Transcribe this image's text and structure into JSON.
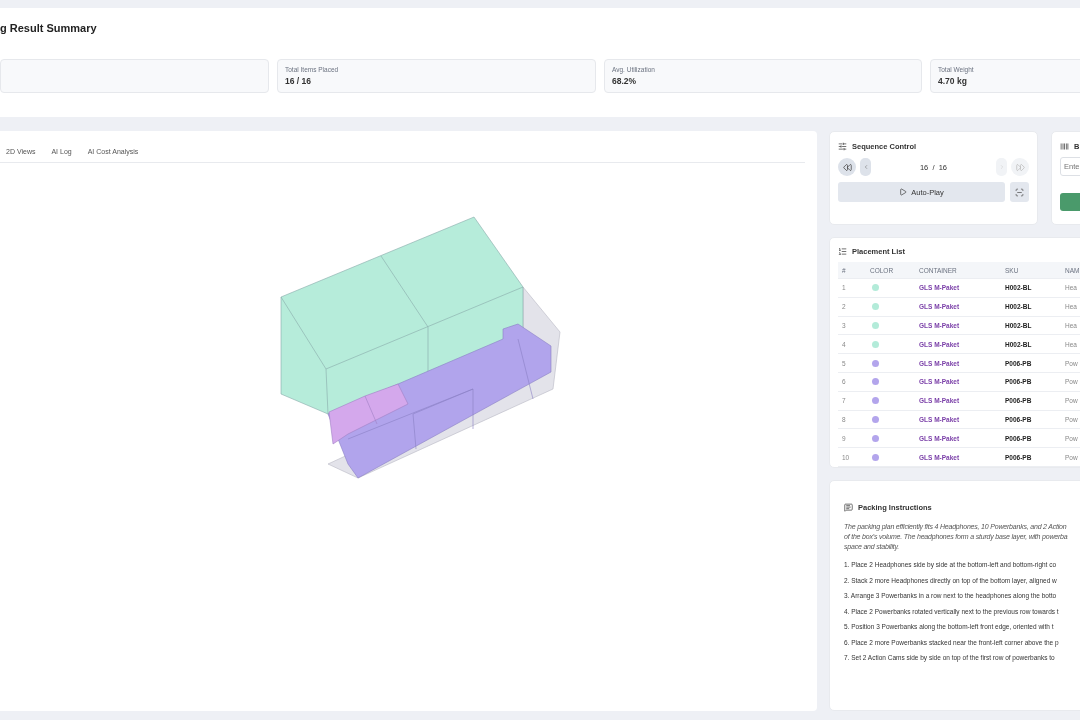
{
  "summary": {
    "title": "g Result Summary",
    "stats": [
      {
        "label": "Total Items Placed",
        "value": "16 / 16"
      },
      {
        "label": "Avg. Utilization",
        "value": "68.2%"
      },
      {
        "label": "Total Weight",
        "value": "4.70 kg"
      }
    ]
  },
  "tabs": [
    {
      "label": "2D Views",
      "selected": false
    },
    {
      "label": "AI Log",
      "selected": false
    },
    {
      "label": "AI Cost Analysis",
      "selected": false
    }
  ],
  "sequence": {
    "title": "Sequence Control",
    "counter": "16  /  16",
    "controls": [
      {
        "kind": "first",
        "disabled": false
      },
      {
        "kind": "prev",
        "disabled": false
      },
      {
        "kind": "next",
        "disabled": true
      },
      {
        "kind": "last",
        "disabled": true
      }
    ],
    "autoplay": "Auto-Play"
  },
  "barcode": {
    "title": "B",
    "placeholder": "Ente"
  },
  "placement": {
    "title": "Placement List",
    "columns": [
      "#",
      "COLOR",
      "CONTAINER",
      "SKU",
      "NAM"
    ],
    "rows": [
      {
        "index": "1",
        "color": "#b3ebd9",
        "container": "GLS M-Paket",
        "sku": "H002-BL",
        "name": "Hea"
      },
      {
        "index": "2",
        "color": "#b3ebd9",
        "container": "GLS M-Paket",
        "sku": "H002-BL",
        "name": "Hea"
      },
      {
        "index": "3",
        "color": "#b3ebd9",
        "container": "GLS M-Paket",
        "sku": "H002-BL",
        "name": "Hea"
      },
      {
        "index": "4",
        "color": "#b3ebd9",
        "container": "GLS M-Paket",
        "sku": "H002-BL",
        "name": "Hea"
      },
      {
        "index": "5",
        "color": "#b3a5ec",
        "container": "GLS M-Paket",
        "sku": "P006-PB",
        "name": "Pow"
      },
      {
        "index": "6",
        "color": "#b3a5ec",
        "container": "GLS M-Paket",
        "sku": "P006-PB",
        "name": "Pow"
      },
      {
        "index": "7",
        "color": "#b3a5ec",
        "container": "GLS M-Paket",
        "sku": "P006-PB",
        "name": "Pow"
      },
      {
        "index": "8",
        "color": "#b3a5ec",
        "container": "GLS M-Paket",
        "sku": "P006-PB",
        "name": "Pow"
      },
      {
        "index": "9",
        "color": "#b3a5ec",
        "container": "GLS M-Paket",
        "sku": "P006-PB",
        "name": "Pow"
      },
      {
        "index": "10",
        "color": "#b3a5ec",
        "container": "GLS M-Paket",
        "sku": "P006-PB",
        "name": "Pow"
      }
    ]
  },
  "instructions": {
    "title": "Packing Instructions",
    "summary_lines": [
      "The packing plan efficiently fits 4 Headphones, 10 Powerbanks, and 2 Action",
      "of the box's volume. The headphones form a sturdy base layer, with powerba",
      "space and stability."
    ],
    "steps": [
      "1. Place 2 Headphones side by side at the bottom-left and bottom-right co",
      "2. Stack 2 more Headphones directly on top of the bottom layer, aligned w",
      "3. Arrange 3 Powerbanks in a row next to the headphones along the botto",
      "4. Place 2 Powerbanks rotated vertically next to the previous row towards t",
      "5. Position 3 Powerbanks along the bottom-left front edge, oriented with t",
      "6. Place 2 more Powerbanks stacked near the front-left corner above the p",
      "7. Set 2 Action Cams side by side on top of the first row of powerbanks to"
    ]
  }
}
